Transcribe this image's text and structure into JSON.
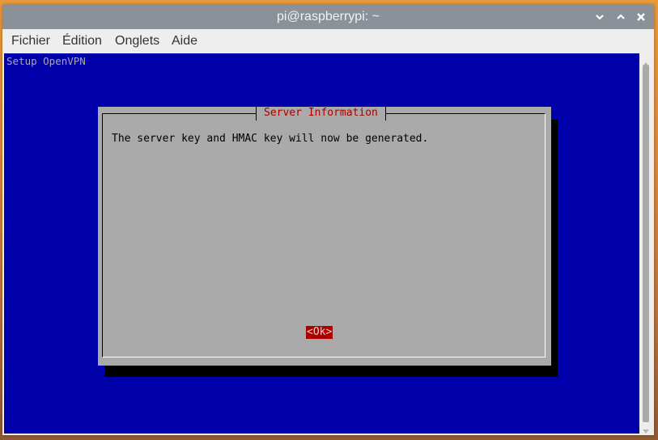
{
  "window": {
    "title": "pi@raspberrypi: ~",
    "controls": {
      "minimize_icon": "chevron-down-icon",
      "maximize_icon": "chevron-up-icon",
      "close_icon": "close-icon"
    }
  },
  "menubar": {
    "items": [
      {
        "label": "Fichier"
      },
      {
        "label": "Édition"
      },
      {
        "label": "Onglets"
      },
      {
        "label": "Aide"
      }
    ]
  },
  "terminal": {
    "backtitle": "Setup OpenVPN",
    "colors": {
      "background": "#0000aa",
      "dialog_bg": "#aaaaaa",
      "title_color": "#aa0000",
      "button_bg": "#aa0000"
    },
    "dialog": {
      "title": "Server Information",
      "message": "The server key and HMAC key will now be generated.",
      "ok_label": "<Ok>"
    }
  }
}
